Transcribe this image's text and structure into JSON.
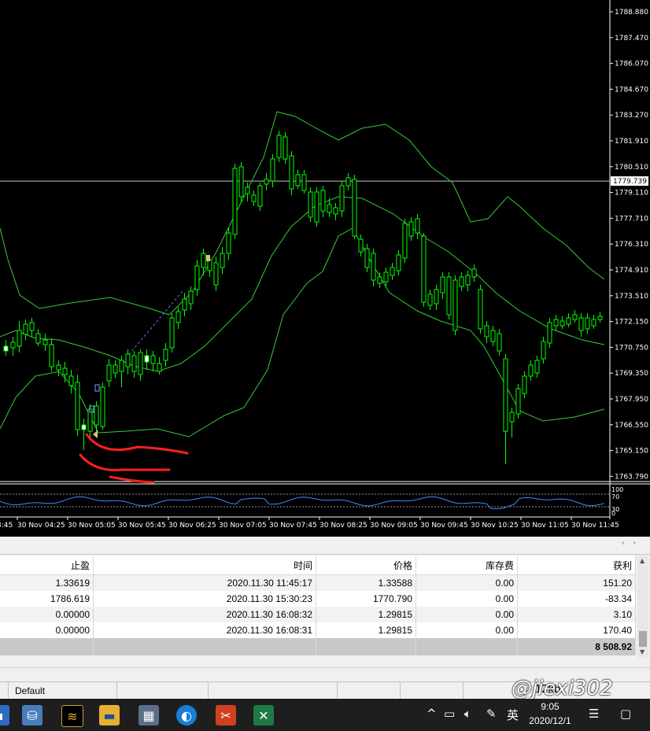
{
  "chart": {
    "price_levels": [
      "1788.880",
      "1787.470",
      "1786.070",
      "1784.670",
      "1783.270",
      "1781.910",
      "1780.510",
      "1779.110",
      "1777.710",
      "1776.310",
      "1774.910",
      "1773.510",
      "1772.150",
      "1770.750",
      "1769.350",
      "1767.950",
      "1766.550",
      "1765.150",
      "1763.790"
    ],
    "current_price": "1779.739",
    "time_labels": [
      "30 Nov 04:25",
      "30 Nov 05:05",
      "30 Nov 05:45",
      "30 Nov 06:25",
      "30 Nov 07:05",
      "30 Nov 07:45",
      "30 Nov 08:25",
      "30 Nov 09:05",
      "30 Nov 09:45",
      "30 Nov 10:25",
      "30 Nov 11:05",
      "30 Nov 11:45"
    ],
    "time_label_partial": "3:45",
    "oscillator_levels": [
      "100",
      "70",
      "30",
      "0"
    ],
    "colors": {
      "background": "#000000",
      "candle": "#00ff00",
      "band": "#33cc33",
      "osc_line": "#3d8cff",
      "annotation": "#ff2020"
    }
  },
  "orders_table": {
    "columns": [
      "止盈",
      "时间",
      "价格",
      "库存费",
      "获利"
    ],
    "rows": [
      {
        "tp": "1.33619",
        "time": "2020.11.30 11:45:17",
        "price": "1.33588",
        "swap": "0.00",
        "profit": "151.20"
      },
      {
        "tp": "1786.619",
        "time": "2020.11.30 15:30:23",
        "price": "1770.790",
        "swap": "0.00",
        "profit": "-83.34"
      },
      {
        "tp": "0.00000",
        "time": "2020.11.30 16:08:32",
        "price": "1.29815",
        "swap": "0.00",
        "profit": "3.10"
      },
      {
        "tp": "0.00000",
        "time": "2020.11.30 16:08:31",
        "price": "1.29815",
        "swap": "0.00",
        "profit": "170.40"
      }
    ],
    "total_profit": "8 508.92"
  },
  "status_bar": {
    "profile": "Default",
    "extra": "12kb"
  },
  "watermark": "@jiexi302",
  "taskbar": {
    "ime": "英",
    "time": "9:05",
    "date": "2020/12/1"
  }
}
